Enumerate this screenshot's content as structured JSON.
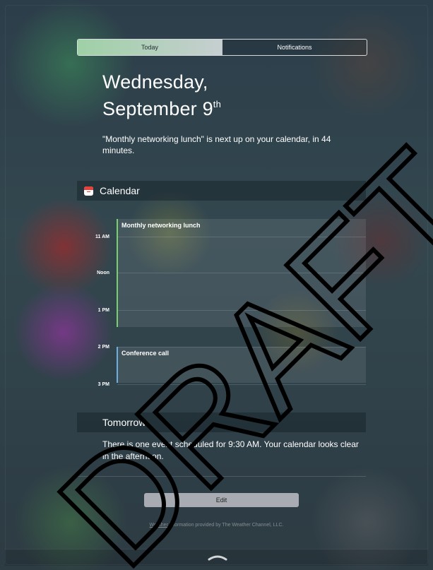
{
  "tabs": [
    {
      "label": "Today",
      "active": true
    },
    {
      "label": "Notifications",
      "active": false
    }
  ],
  "date": {
    "weekday_line": "Wednesday,",
    "month_day": "September 9",
    "suffix": "th"
  },
  "summary": "\"Monthly networking lunch\" is next up on your calendar, in 44 minutes.",
  "calendar": {
    "title": "Calendar",
    "icon": "calendar-icon",
    "time_labels": [
      "11 AM",
      "Noon",
      "1 PM",
      "2 PM",
      "3 PM"
    ],
    "events": [
      {
        "title": "Monthly networking lunch",
        "color": "#7bd06e"
      },
      {
        "title": "Conference call",
        "color": "#6bb0e0"
      }
    ]
  },
  "tomorrow": {
    "title": "Tomorrow",
    "text": "There is one event scheduled for 9:30 AM. Your calendar looks clear in the afternoon."
  },
  "edit_label": "Edit",
  "credit": {
    "link": "Weather",
    "rest": " information provided by The Weather Channel, LLC."
  },
  "watermark": "DRAFT"
}
